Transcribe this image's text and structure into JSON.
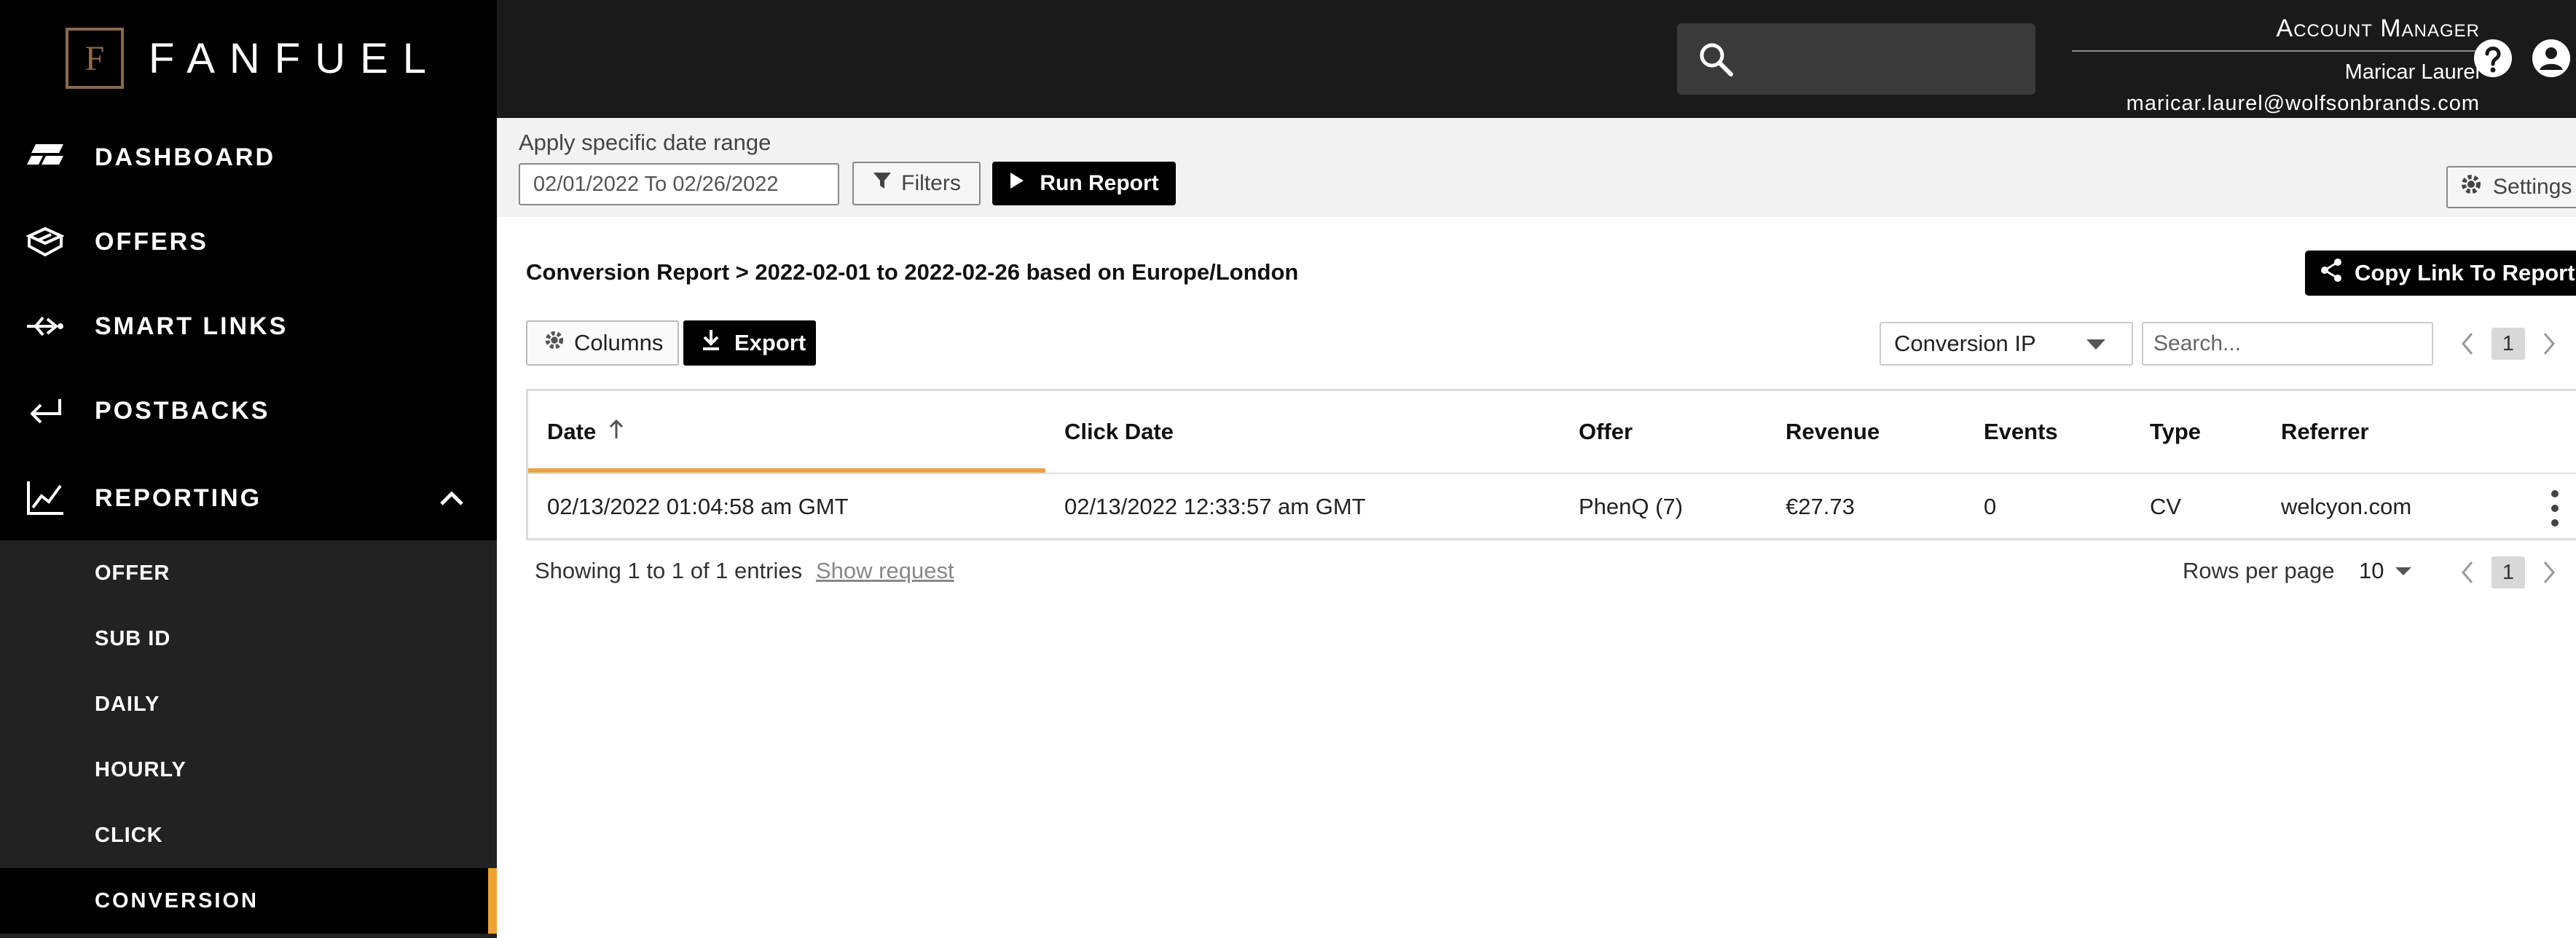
{
  "brand": {
    "logo_letter": "F",
    "name": "FANFUEL",
    "accent_color": "#f0a030"
  },
  "sidebar": {
    "items": [
      {
        "label": "DASHBOARD",
        "icon": "dashboard-icon"
      },
      {
        "label": "OFFERS",
        "icon": "offers-box-icon"
      },
      {
        "label": "SMART LINKS",
        "icon": "smart-links-icon"
      },
      {
        "label": "POSTBACKS",
        "icon": "postbacks-arrow-icon"
      },
      {
        "label": "REPORTING",
        "icon": "reporting-chart-icon",
        "expanded": true
      }
    ],
    "reporting_sub": [
      {
        "label": "OFFER"
      },
      {
        "label": "SUB ID"
      },
      {
        "label": "DAILY"
      },
      {
        "label": "HOURLY"
      },
      {
        "label": "CLICK"
      },
      {
        "label": "CONVERSION",
        "active": true
      }
    ]
  },
  "header": {
    "account_title": "Account Manager",
    "account_name": "Maricar Laurel",
    "account_email": "maricar.laurel@wolfsonbrands.com"
  },
  "filters": {
    "date_range_label": "Apply specific date range",
    "date_range_value": "02/01/2022 To 02/26/2022",
    "filters_label": "Filters",
    "run_label": "Run Report",
    "settings_label": "Settings"
  },
  "report": {
    "title": "Conversion Report > 2022-02-01 to 2022-02-26 based on Europe/London",
    "copy_link_label": "Copy Link To Report",
    "columns_label": "Columns",
    "export_label": "Export",
    "group_select_value": "Conversion IP",
    "search_placeholder": "Search...",
    "current_page": "1",
    "columns": [
      "Date",
      "Click Date",
      "Offer",
      "Revenue",
      "Events",
      "Type",
      "Referrer"
    ],
    "rows": [
      [
        "02/13/2022 01:04:58 am GMT",
        "02/13/2022 12:33:57 am GMT",
        "PhenQ (7)",
        "€27.73",
        "0",
        "CV",
        "welcyon.com"
      ]
    ],
    "showing_text": "Showing 1 to 1 of 1 entries",
    "show_request_label": "Show request",
    "rows_per_page_label": "Rows per page",
    "rows_per_page_value": "10"
  }
}
